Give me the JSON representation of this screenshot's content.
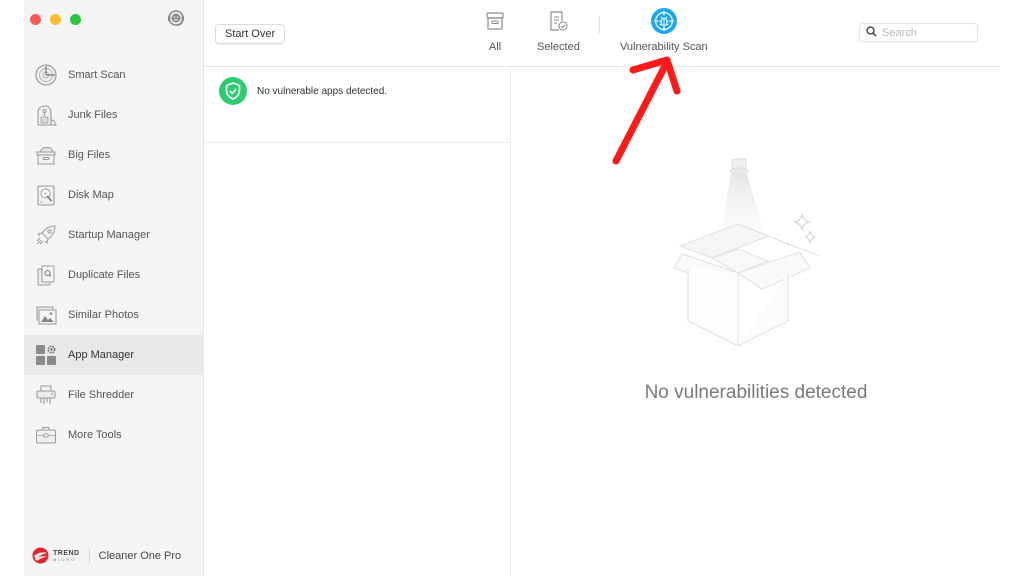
{
  "window": {
    "controls": [
      "close",
      "minimize",
      "zoom"
    ]
  },
  "header": {
    "support_icon": "support-agent-icon"
  },
  "sidebar": {
    "items": [
      {
        "label": "Smart Scan",
        "icon": "radar-icon",
        "active": false
      },
      {
        "label": "Junk Files",
        "icon": "vacuum-icon",
        "active": false
      },
      {
        "label": "Big Files",
        "icon": "storage-box-icon",
        "active": false
      },
      {
        "label": "Disk Map",
        "icon": "disk-map-icon",
        "active": false
      },
      {
        "label": "Startup Manager",
        "icon": "rocket-icon",
        "active": false
      },
      {
        "label": "Duplicate Files",
        "icon": "duplicate-files-icon",
        "active": false
      },
      {
        "label": "Similar Photos",
        "icon": "photos-icon",
        "active": false
      },
      {
        "label": "App Manager",
        "icon": "app-grid-gear-icon",
        "active": true
      },
      {
        "label": "File Shredder",
        "icon": "shredder-icon",
        "active": false
      },
      {
        "label": "More Tools",
        "icon": "toolbox-icon",
        "active": false
      }
    ],
    "brand": {
      "company_line1": "TREND",
      "company_line2": "MICRO",
      "product": "Cleaner One Pro"
    }
  },
  "toolbar": {
    "start_over_label": "Start Over",
    "tabs": [
      {
        "label": "All",
        "icon": "archive-box-icon",
        "active": false
      },
      {
        "label": "Selected",
        "icon": "checked-document-icon",
        "active": false
      },
      {
        "label": "Vulnerability Scan",
        "icon": "bug-target-icon",
        "active": true
      }
    ],
    "search": {
      "placeholder": "Search",
      "value": ""
    }
  },
  "list": {
    "status_message": "No vulnerable apps detected.",
    "status_icon": "shield-check-icon"
  },
  "detail": {
    "empty_message": "No vulnerabilities detected",
    "illustration": "empty-box-spotlight"
  },
  "colors": {
    "accent_blue": "#1aa7ec",
    "success_green": "#2ecc71",
    "annotation_red": "#ff1a1a"
  }
}
